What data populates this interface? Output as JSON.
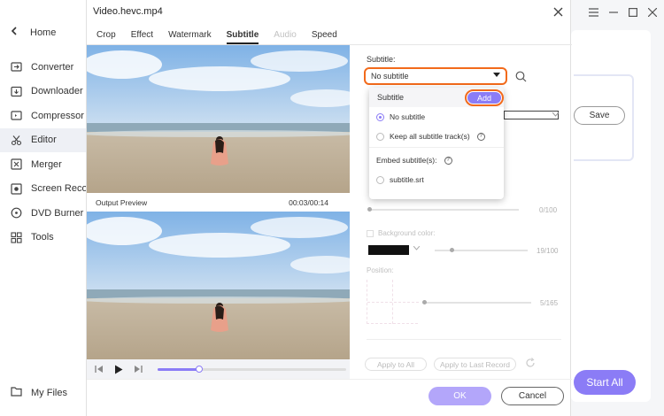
{
  "sidebar": {
    "home_label": "Home",
    "items": [
      {
        "label": "Converter",
        "icon": "converter-icon"
      },
      {
        "label": "Downloader",
        "icon": "downloader-icon"
      },
      {
        "label": "Compressor",
        "icon": "compressor-icon"
      },
      {
        "label": "Editor",
        "icon": "editor-icon",
        "active": true
      },
      {
        "label": "Merger",
        "icon": "merger-icon"
      },
      {
        "label": "Screen Recorder",
        "icon": "screen-recorder-icon"
      },
      {
        "label": "DVD Burner",
        "icon": "dvd-burner-icon"
      },
      {
        "label": "Tools",
        "icon": "tools-icon"
      }
    ],
    "my_files_label": "My Files"
  },
  "background": {
    "save_label": "Save",
    "start_all_label": "Start All"
  },
  "dialog": {
    "title": "Video.hevc.mp4",
    "tabs": [
      {
        "label": "Crop",
        "state": "normal"
      },
      {
        "label": "Effect",
        "state": "normal"
      },
      {
        "label": "Watermark",
        "state": "normal"
      },
      {
        "label": "Subtitle",
        "state": "active"
      },
      {
        "label": "Audio",
        "state": "disabled"
      },
      {
        "label": "Speed",
        "state": "normal"
      }
    ],
    "output_preview_label": "Output Preview",
    "time_display": "00:03/00:14",
    "playback_progress": 0.22,
    "subtitle_label": "Subtitle:",
    "subtitle_value": "No subtitle",
    "transparency_value": "0/100",
    "background_color_label": "Background color:",
    "background_value": "19/100",
    "position_label": "Position:",
    "position_value": "5/165",
    "apply_to_all_label": "Apply to All",
    "apply_to_last_label": "Apply to Last Record",
    "ok_label": "OK",
    "cancel_label": "Cancel"
  },
  "dropdown": {
    "header_label": "Subtitle",
    "add_label": "Add",
    "options": [
      {
        "label": "No subtitle",
        "selected": true
      },
      {
        "label": "Keep all subtitle track(s)",
        "selected": false
      }
    ],
    "embed_label": "Embed subtitle(s):",
    "embedded": [
      {
        "label": "subtitle.srt",
        "selected": false
      }
    ]
  },
  "colors": {
    "accent": "#8b7cf6",
    "highlight": "#f26a1b"
  }
}
